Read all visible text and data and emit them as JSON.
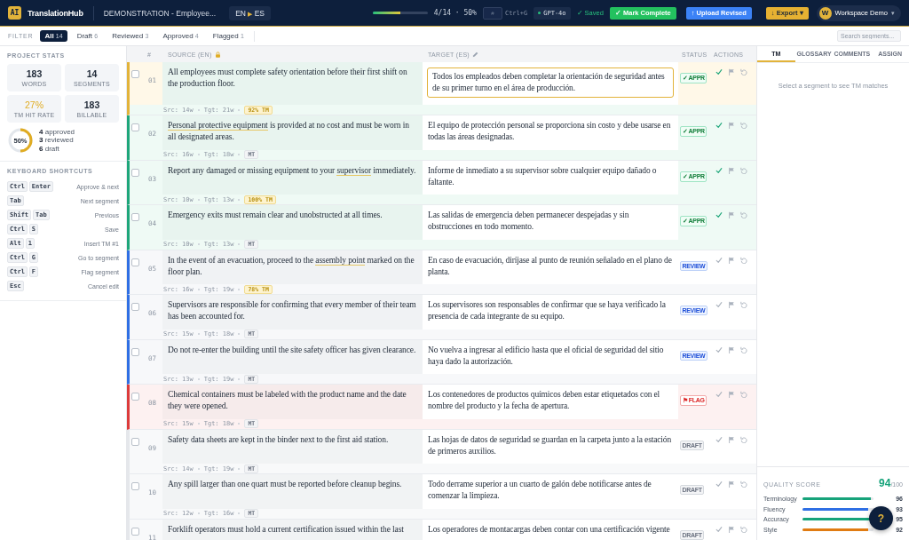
{
  "topbar": {
    "logo": "AI",
    "app_name": "TranslationHub",
    "document": "DEMONSTRATION - Employee...",
    "lang_from": "EN",
    "lang_arrow": "▶",
    "lang_to": "ES",
    "progress": {
      "level": 0.5
    },
    "progress_text": "4/14 · 50%",
    "goto": {
      "placeholder": "#"
    },
    "goto_hint": "Ctrl+G",
    "model": "GPT-4o",
    "saved": "✓ Saved",
    "buttons": [
      {
        "label": "✓ Mark Complete",
        "kind": "success"
      },
      {
        "label": "↑ Upload Revised",
        "kind": "primary"
      },
      {
        "label": "↓ Export ▾",
        "kind": "warning"
      }
    ],
    "user": {
      "initial": "W",
      "name": "Workspace Demo",
      "caret": "▾"
    }
  },
  "filter": {
    "label": "FILTER",
    "tabs": [
      {
        "label": "All",
        "count": "14",
        "selected": true
      },
      {
        "label": "Draft",
        "count": "6",
        "selected": false
      },
      {
        "label": "Reviewed",
        "count": "3",
        "selected": false
      },
      {
        "label": "Approved",
        "count": "4",
        "selected": false
      },
      {
        "label": "Flagged",
        "count": "1",
        "selected": false
      }
    ],
    "search": {
      "placeholder": "Search segments..."
    }
  },
  "sidebar": {
    "stats_title": "PROJECT STATS",
    "stats": [
      {
        "value": "183",
        "label": "WORDS",
        "kind": "plain"
      },
      {
        "value": "14",
        "label": "SEGMENTS",
        "kind": "plain"
      },
      {
        "value": "27%",
        "label": "TM HIT RATE",
        "kind": "accent"
      },
      {
        "value": "183",
        "label": "BILLABLE",
        "kind": "plain"
      }
    ],
    "ring": {
      "level": 0.5,
      "label": "50%"
    },
    "legend": [
      "**4** approved",
      "**3** reviewed",
      "**6** draft"
    ],
    "shortcuts_title": "KEYBOARD SHORTCUTS",
    "shortcuts": [
      {
        "keys": [
          "Ctrl",
          "Enter"
        ],
        "action": "Approve & next"
      },
      {
        "keys": [
          "Tab"
        ],
        "action": "Next segment"
      },
      {
        "keys": [
          "Shift",
          "Tab"
        ],
        "action": "Previous"
      },
      {
        "keys": [
          "Ctrl",
          "S"
        ],
        "action": "Save"
      },
      {
        "keys": [
          "Alt",
          "1"
        ],
        "action": "Insert TM #1"
      },
      {
        "keys": [
          "Ctrl",
          "G"
        ],
        "action": "Go to segment"
      },
      {
        "keys": [
          "Ctrl",
          "F"
        ],
        "action": "Flag segment"
      },
      {
        "keys": [
          "Esc"
        ],
        "action": "Cancel edit"
      }
    ]
  },
  "table": {
    "columns": [
      "#",
      "SOURCE (EN)",
      "TARGET (ES)",
      "STATUS",
      "ACTIONS"
    ],
    "rows": [
      {
        "number": "01",
        "checked": false,
        "active": true,
        "kind": "approved",
        "badge": "✓ APPR",
        "source": [
          {
            "text": "All employees must complete safety orientation before their first shift on the production floor.",
            "term": false
          }
        ],
        "target": "Todos los empleados deben completar la orientación de seguridad antes de su primer turno en el área de producción.",
        "src": "Src: 14w",
        "tgt": "Tgt: 21w",
        "match": {
          "label": "92% TM",
          "kind": "tm"
        }
      },
      {
        "number": "02",
        "checked": false,
        "active": false,
        "kind": "approved",
        "badge": "✓ APPR",
        "source": [
          {
            "text": "Personal protective equipment",
            "term": true
          },
          {
            "text": " is provided at no cost and must be worn in all designated areas.",
            "term": false
          }
        ],
        "target": "El equipo de protección personal se proporciona sin costo y debe usarse en todas las áreas designadas.",
        "src": "Src: 16w",
        "tgt": "Tgt: 18w",
        "match": {
          "label": "MT",
          "kind": "mt"
        }
      },
      {
        "number": "03",
        "checked": false,
        "active": false,
        "kind": "approved",
        "badge": "✓ APPR",
        "source": [
          {
            "text": "Report any damaged or missing equipment to your ",
            "term": false
          },
          {
            "text": "supervisor",
            "term": true
          },
          {
            "text": " immediately.",
            "term": false
          }
        ],
        "target": "Informe de inmediato a su supervisor sobre cualquier equipo dañado o faltante.",
        "src": "Src: 10w",
        "tgt": "Tgt: 13w",
        "match": {
          "label": "100% TM",
          "kind": "tm"
        }
      },
      {
        "number": "04",
        "checked": false,
        "active": false,
        "kind": "approved",
        "badge": "✓ APPR",
        "source": [
          {
            "text": "Emergency exits must remain clear and unobstructed at all times.",
            "term": false
          }
        ],
        "target": "Las salidas de emergencia deben permanecer despejadas y sin obstrucciones en todo momento.",
        "src": "Src: 10w",
        "tgt": "Tgt: 13w",
        "match": {
          "label": "MT",
          "kind": "mt"
        }
      },
      {
        "number": "05",
        "checked": false,
        "active": false,
        "kind": "review",
        "badge": "REVIEW",
        "source": [
          {
            "text": "In the event of an evacuation, proceed to the ",
            "term": false
          },
          {
            "text": "assembly point",
            "term": true
          },
          {
            "text": " marked on the floor plan.",
            "term": false
          }
        ],
        "target": "En caso de evacuación, diríjase al punto de reunión señalado en el plano de planta.",
        "src": "Src: 16w",
        "tgt": "Tgt: 19w",
        "match": {
          "label": "78% TM",
          "kind": "tm"
        }
      },
      {
        "number": "06",
        "checked": false,
        "active": false,
        "kind": "review",
        "badge": "REVIEW",
        "source": [
          {
            "text": "Supervisors are responsible for confirming that every member of their team has been accounted for.",
            "term": false
          }
        ],
        "target": "Los supervisores son responsables de confirmar que se haya verificado la presencia de cada integrante de su equipo.",
        "src": "Src: 15w",
        "tgt": "Tgt: 18w",
        "match": {
          "label": "MT",
          "kind": "mt"
        }
      },
      {
        "number": "07",
        "checked": false,
        "active": false,
        "kind": "review",
        "badge": "REVIEW",
        "source": [
          {
            "text": "Do not re-enter the building until the site safety officer has given clearance.",
            "term": false
          }
        ],
        "target": "No vuelva a ingresar al edificio hasta que el oficial de seguridad del sitio haya dado la autorización.",
        "src": "Src: 13w",
        "tgt": "Tgt: 19w",
        "match": {
          "label": "MT",
          "kind": "mt"
        }
      },
      {
        "number": "08",
        "checked": false,
        "active": false,
        "kind": "flagged",
        "badge": "⚑ FLAG",
        "source": [
          {
            "text": "Chemical containers must be labeled with the product name and the date they were opened.",
            "term": false
          }
        ],
        "target": "Los contenedores de productos químicos deben estar etiquetados con el nombre del producto y la fecha de apertura.",
        "src": "Src: 15w",
        "tgt": "Tgt: 18w",
        "match": {
          "label": "MT",
          "kind": "mt"
        }
      },
      {
        "number": "09",
        "checked": false,
        "active": false,
        "kind": "draft",
        "badge": "DRAFT",
        "source": [
          {
            "text": "Safety data sheets are kept in the binder next to the first aid station.",
            "term": false
          }
        ],
        "target": "Las hojas de datos de seguridad se guardan en la carpeta junto a la estación de primeros auxilios.",
        "src": "Src: 14w",
        "tgt": "Tgt: 19w",
        "match": {
          "label": "MT",
          "kind": "mt"
        }
      },
      {
        "number": "10",
        "checked": false,
        "active": false,
        "kind": "draft",
        "badge": "DRAFT",
        "source": [
          {
            "text": "Any spill larger than one quart must be reported before cleanup begins.",
            "term": false
          }
        ],
        "target": "Todo derrame superior a un cuarto de galón debe notificarse antes de comenzar la limpieza.",
        "src": "Src: 12w",
        "tgt": "Tgt: 16w",
        "match": {
          "label": "MT",
          "kind": "mt"
        }
      },
      {
        "number": "11",
        "checked": false,
        "active": false,
        "kind": "draft",
        "badge": "DRAFT",
        "source": [
          {
            "text": "Forklift operators must hold a current certification issued within the last",
            "term": false
          }
        ],
        "target": "Los operadores de montacargas deben contar con una certificación vigente"
      }
    ]
  },
  "panel": {
    "tabs": [
      {
        "label": "TM",
        "selected": true
      },
      {
        "label": "GLOSSARY",
        "selected": false
      },
      {
        "label": "COMMENTS",
        "selected": false
      },
      {
        "label": "ASSIGN",
        "selected": false
      }
    ],
    "empty_message": "Select a segment to see TM matches",
    "quality": {
      "title": "QUALITY SCORE",
      "score": "94",
      "out_of": "/100",
      "metrics": [
        {
          "name": "Terminology",
          "level": 0.96,
          "value": "96",
          "color": "#16a37a"
        },
        {
          "name": "Fluency",
          "level": 0.93,
          "value": "93",
          "color": "#2f6fe4"
        },
        {
          "name": "Accuracy",
          "level": 0.95,
          "value": "95",
          "color": "#16a37a"
        },
        {
          "name": "Style",
          "level": 0.92,
          "value": "92",
          "color": "#e07b12"
        }
      ]
    }
  },
  "help_button": "?"
}
